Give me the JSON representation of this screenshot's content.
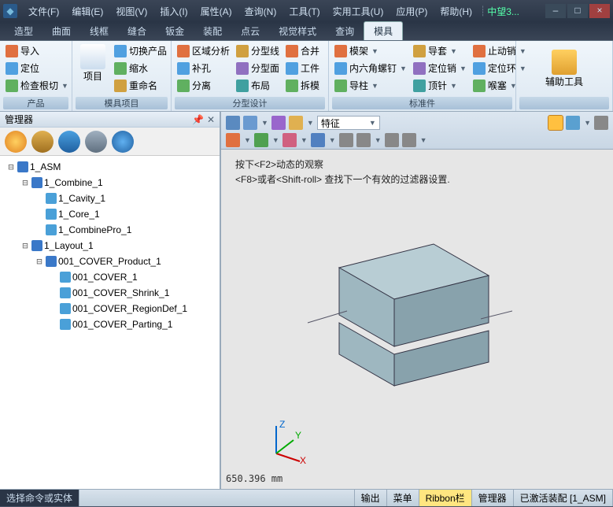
{
  "menu": [
    "文件(F)",
    "编辑(E)",
    "视图(V)",
    "插入(I)",
    "属性(A)",
    "查询(N)",
    "工具(T)",
    "实用工具(U)",
    "应用(P)",
    "帮助(H)"
  ],
  "brand": "中望3...",
  "tabs": [
    "造型",
    "曲面",
    "线框",
    "缝合",
    "钣金",
    "装配",
    "点云",
    "视觉样式",
    "查询",
    "模具"
  ],
  "active_tab": 9,
  "ribbon": {
    "g0": {
      "label": "产品",
      "items": [
        "导入",
        "定位",
        "检查根切"
      ]
    },
    "g1": {
      "label": "模具项目",
      "big": "项目",
      "items": [
        "切换产品",
        "缩水",
        "重命名"
      ]
    },
    "g2": {
      "label": "分型设计",
      "c1": [
        "区域分析",
        "补孔",
        "分离"
      ],
      "c2": [
        "分型线",
        "分型面",
        "布局"
      ],
      "c3": [
        "合并",
        "工件",
        "拆模"
      ]
    },
    "g3": {
      "label": "标准件",
      "c1": [
        "模架",
        "内六角螺钉",
        "导柱"
      ],
      "c2": [
        "导套",
        "定位销",
        "顶针"
      ],
      "c3": [
        "止动销",
        "定位环",
        "喉塞"
      ]
    },
    "g4": {
      "label": "",
      "big": "辅助工具"
    }
  },
  "sidebar_title": "管理器",
  "tree": [
    {
      "d": 0,
      "exp": "-",
      "ic": "#3a78c8",
      "t": "1_ASM"
    },
    {
      "d": 1,
      "exp": "-",
      "ic": "#3a78c8",
      "t": "1_Combine_1"
    },
    {
      "d": 2,
      "exp": "",
      "ic": "#4aa0d8",
      "t": "1_Cavity_1"
    },
    {
      "d": 2,
      "exp": "",
      "ic": "#4aa0d8",
      "t": "1_Core_1"
    },
    {
      "d": 2,
      "exp": "",
      "ic": "#4aa0d8",
      "t": "1_CombinePro_1"
    },
    {
      "d": 1,
      "exp": "-",
      "ic": "#3a78c8",
      "t": "1_Layout_1"
    },
    {
      "d": 2,
      "exp": "-",
      "ic": "#3a78c8",
      "t": "001_COVER_Product_1"
    },
    {
      "d": 3,
      "exp": "",
      "ic": "#4aa0d8",
      "t": "001_COVER_1"
    },
    {
      "d": 3,
      "exp": "",
      "ic": "#4aa0d8",
      "t": "001_COVER_Shrink_1"
    },
    {
      "d": 3,
      "exp": "",
      "ic": "#4aa0d8",
      "t": "001_COVER_RegionDef_1"
    },
    {
      "d": 3,
      "exp": "",
      "ic": "#4aa0d8",
      "t": "001_COVER_Parting_1"
    }
  ],
  "vp_select": "特征",
  "hint1": "按下<F2>动态的观察",
  "hint2": "<F8>或者<Shift-roll> 查找下一个有效的过滤器设置.",
  "dim": "650.396 mm",
  "status": {
    "prompt": "选择命令或实体",
    "cells": [
      "输出",
      "菜单",
      "Ribbon栏",
      "管理器"
    ],
    "asm": "已激活装配 [1_ASM]"
  }
}
